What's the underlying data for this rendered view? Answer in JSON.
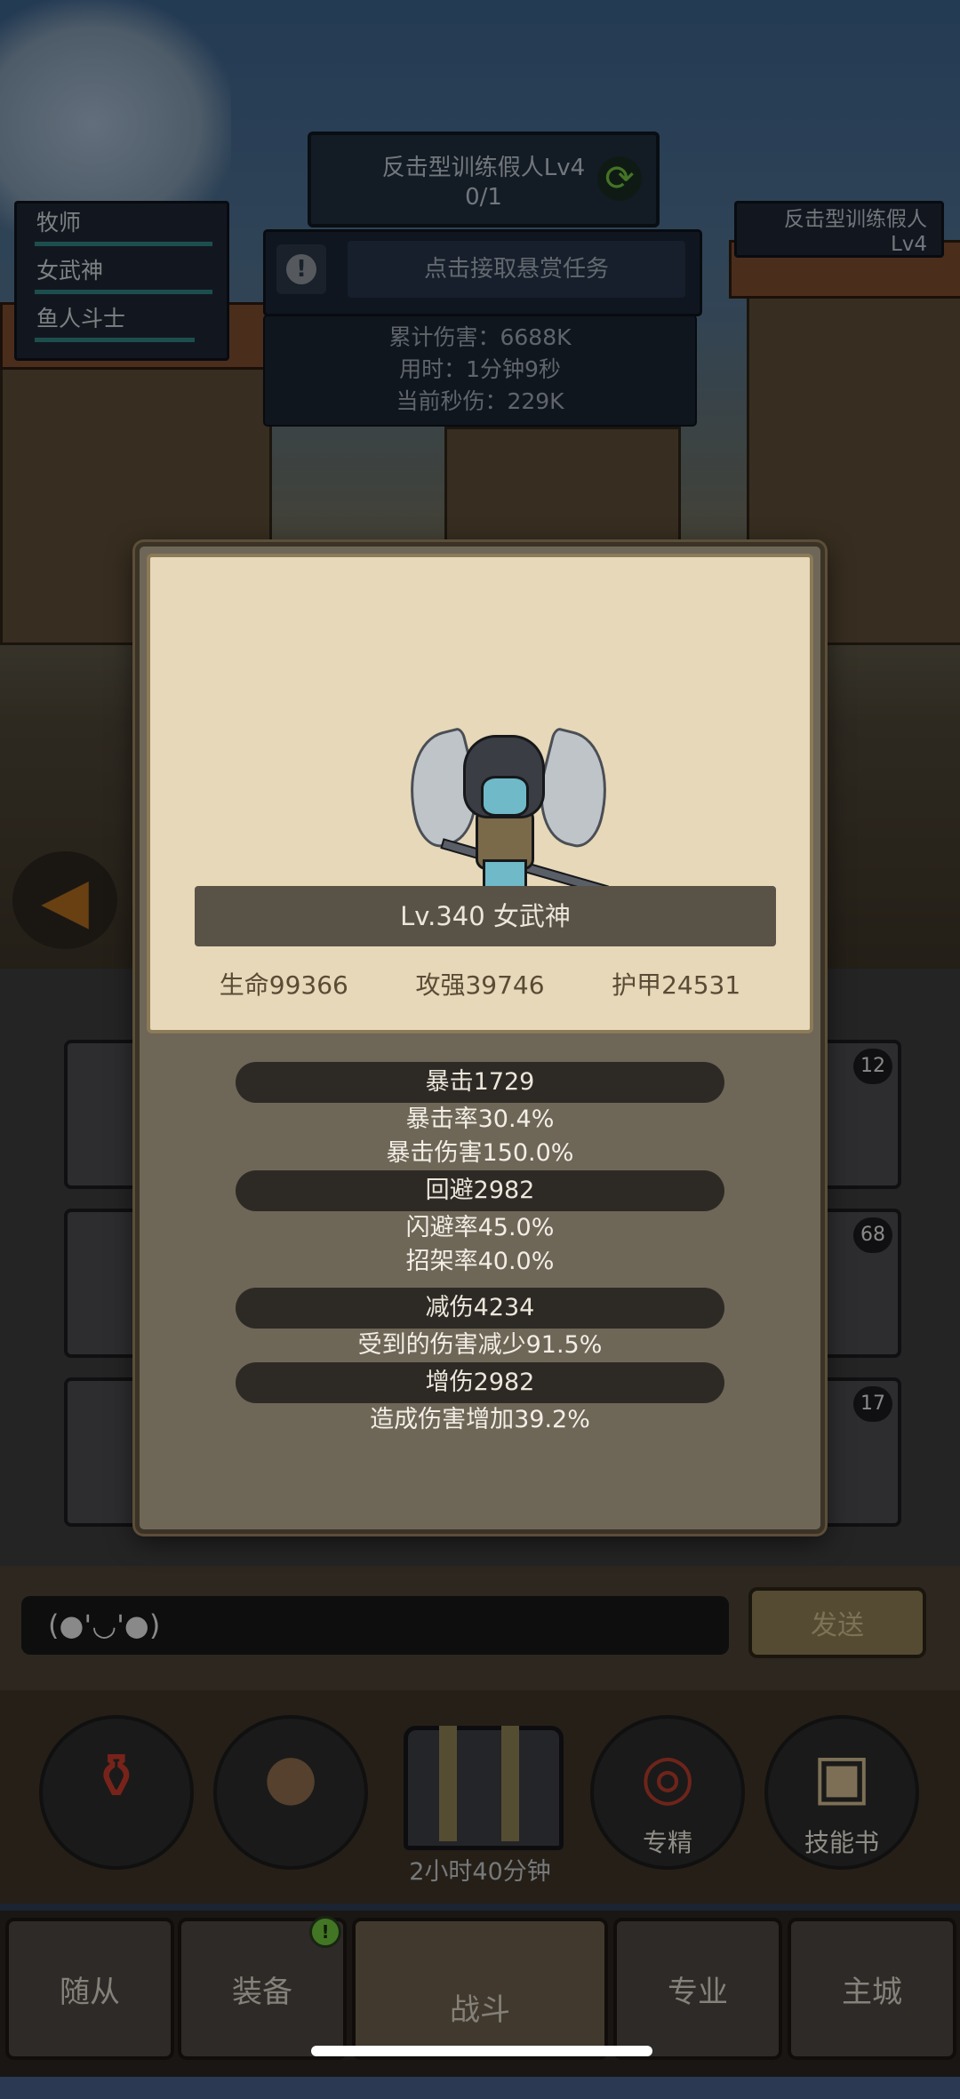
{
  "top": {
    "quest_title": "反击型训练假人Lv4",
    "quest_progress": "0/1",
    "bounty_button": "点击接取悬赏任务",
    "target_name": "反击型训练假人",
    "target_level": "Lv4",
    "party": [
      "牧师",
      "女武神",
      "鱼人斗士"
    ],
    "stats": {
      "total_damage": "累计伤害：6688K",
      "time_used": "用时：1分钟9秒",
      "dps": "当前秒伤：229K"
    }
  },
  "hero_card": {
    "name_line": "Lv.340 女武神",
    "base_stats": {
      "hp": "生命99366",
      "attack": "攻强39746",
      "armor": "护甲24531"
    },
    "details": {
      "crit_header": "暴击1729",
      "crit_rate": "暴击率30.4%",
      "crit_damage": "暴击伤害150.0%",
      "evade_header": "回避2982",
      "dodge_rate": "闪避率45.0%",
      "parry_rate": "招架率40.0%",
      "reduce_header": "减伤4234",
      "reduce_desc": "受到的伤害减少91.5%",
      "boost_header": "增伤2982",
      "boost_desc": "造成伤害增加39.2%"
    }
  },
  "inventory_badges": [
    "12",
    "68",
    "17"
  ],
  "chat": {
    "input_value": "(●'◡'●)",
    "send_label": "发送"
  },
  "actions": {
    "specialization_label": "专精",
    "skillbook_label": "技能书",
    "chest_timer": "2小时40分钟"
  },
  "nav": {
    "tabs": [
      "随从",
      "装备",
      "战斗",
      "专业",
      "主城"
    ],
    "equip_badge": "!"
  }
}
